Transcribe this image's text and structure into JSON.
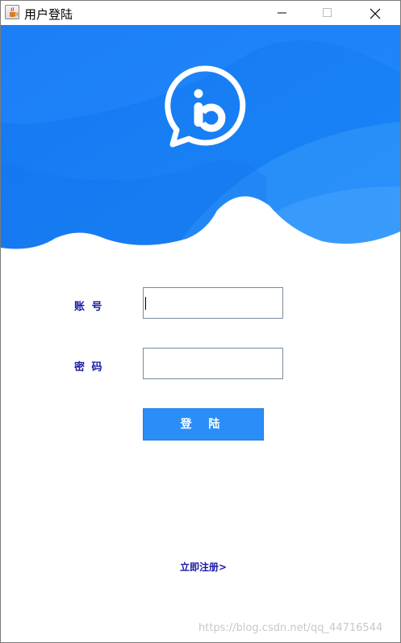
{
  "window": {
    "title": "用户登陆",
    "icon": "java-cup-icon",
    "controls": [
      "minimize-icon",
      "maximize-icon",
      "close-icon"
    ]
  },
  "banner": {
    "logo": "chat-bubble-b-icon",
    "colors": {
      "primary": "#1a7ef5",
      "light": "#3fa0ff",
      "wave_shadow": "#c3c8e4"
    }
  },
  "form": {
    "account_label": "账 号",
    "account_value": "",
    "password_label": "密 码",
    "password_value": "",
    "login_label": "登 陆",
    "register_label": "立即注册>"
  },
  "watermark": "https://blog.csdn.net/qq_44716544",
  "colors": {
    "label": "#1a1aa6",
    "button": "#2b8ef8"
  }
}
